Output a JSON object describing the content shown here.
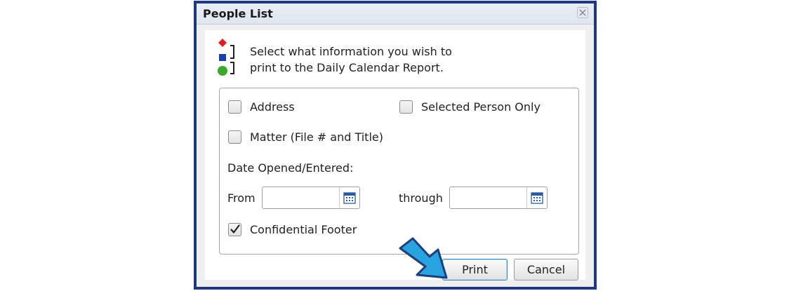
{
  "dialog": {
    "title": "People List",
    "instructions_line1": "Select what information you wish to",
    "instructions_line2": "print to the Daily Calendar Report."
  },
  "options": {
    "address": {
      "label": "Address",
      "checked": false
    },
    "selected_person_only": {
      "label": "Selected Person Only",
      "checked": false
    },
    "matter": {
      "label": "Matter (File # and Title)",
      "checked": false
    },
    "date_label": "Date Opened/Entered:",
    "from_label": "From",
    "from_value": "",
    "through_label": "through",
    "through_value": "",
    "confidential_footer": {
      "label": "Confidential Footer",
      "checked": true
    }
  },
  "buttons": {
    "print": "Print",
    "cancel": "Cancel"
  },
  "colors": {
    "frame_border": "#1f3a7c",
    "arrow_fill": "#29a3e0",
    "arrow_stroke": "#1a3f7a"
  },
  "icons": {
    "close": "close-icon",
    "info": "shapes-info-icon",
    "calendar": "calendar-icon",
    "checkmark": "checkmark-icon",
    "pointer": "arrow-pointer-icon"
  }
}
